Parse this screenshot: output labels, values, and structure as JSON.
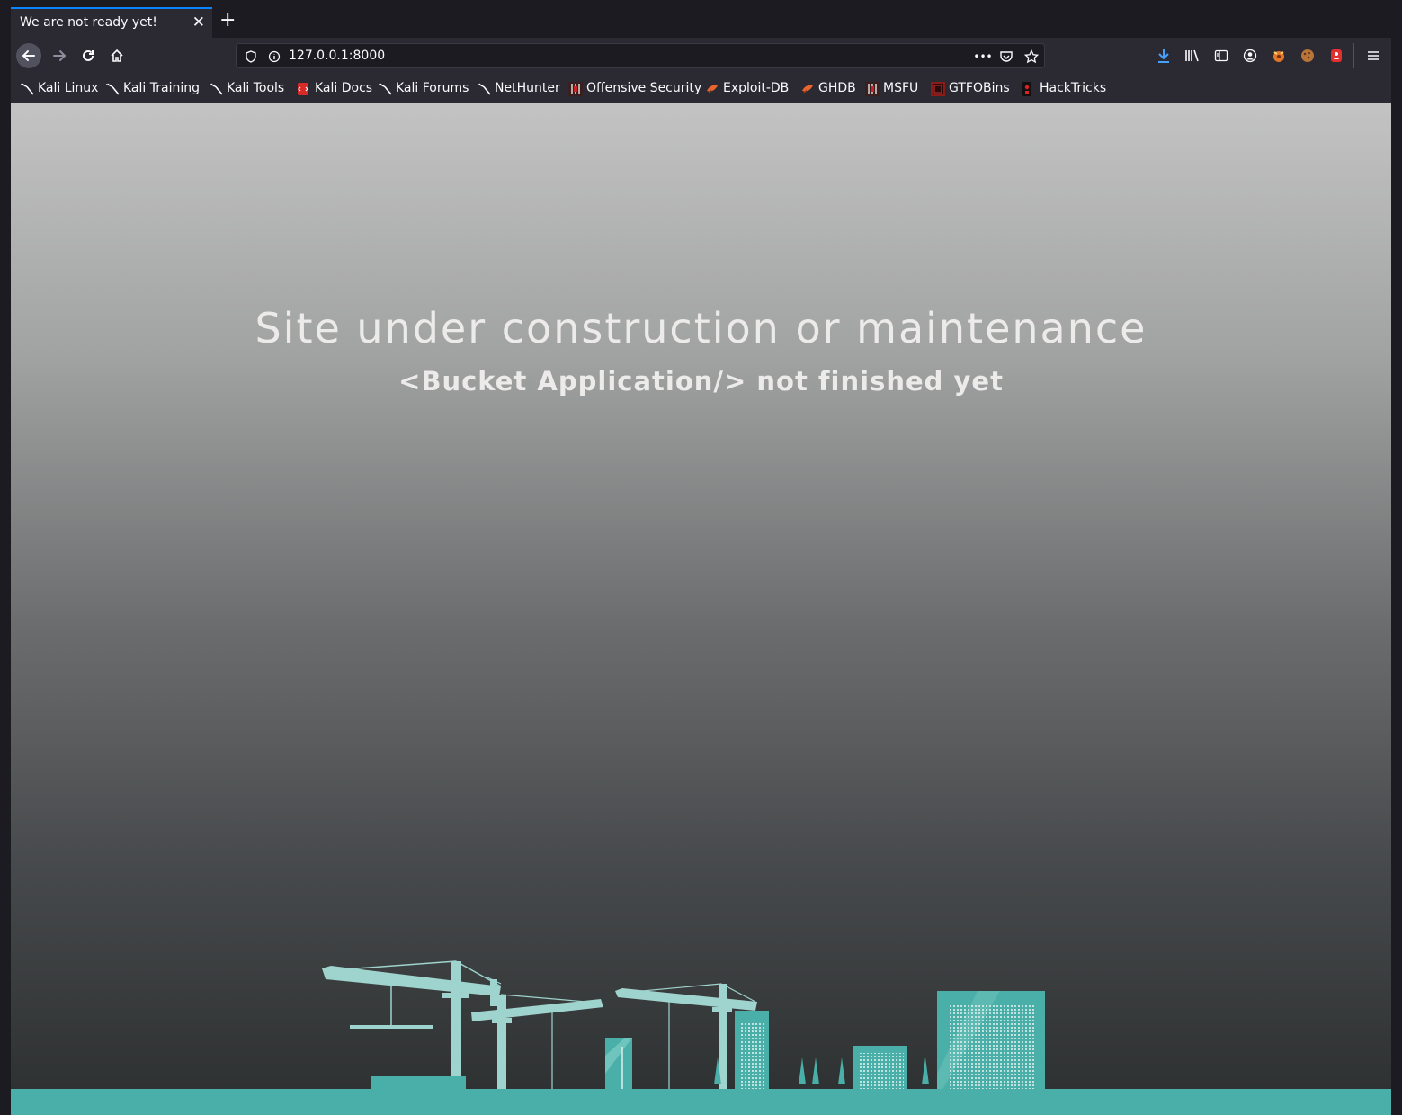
{
  "browser": {
    "tab_title": "We are not ready yet!",
    "tab_close_glyph": "✕",
    "new_tab_glyph": "+",
    "url": "127.0.0.1:8000",
    "page_actions_glyph": "•••"
  },
  "bookmarks": [
    {
      "label": "Kali Linux",
      "icon": "kali-dragon-icon"
    },
    {
      "label": "Kali Training",
      "icon": "kali-dragon-icon"
    },
    {
      "label": "Kali Tools",
      "icon": "kali-dragon-icon"
    },
    {
      "label": "Kali Docs",
      "icon": "kali-docs-icon"
    },
    {
      "label": "Kali Forums",
      "icon": "kali-dragon-icon"
    },
    {
      "label": "NetHunter",
      "icon": "kali-dragon-icon"
    },
    {
      "label": "Offensive Security",
      "icon": "offsec-icon"
    },
    {
      "label": "Exploit-DB",
      "icon": "exploitdb-icon"
    },
    {
      "label": "GHDB",
      "icon": "exploitdb-icon"
    },
    {
      "label": "MSFU",
      "icon": "offsec-icon"
    },
    {
      "label": "GTFOBins",
      "icon": "gtfobins-icon"
    },
    {
      "label": "HackTricks",
      "icon": "hacktricks-icon"
    }
  ],
  "page": {
    "heading": "Site under construction or maintenance",
    "subheading": "<Bucket Application/> not finished yet"
  },
  "colors": {
    "ground": "#4aafa8",
    "building": "#4aafa8",
    "crane": "#9fd3cd"
  }
}
